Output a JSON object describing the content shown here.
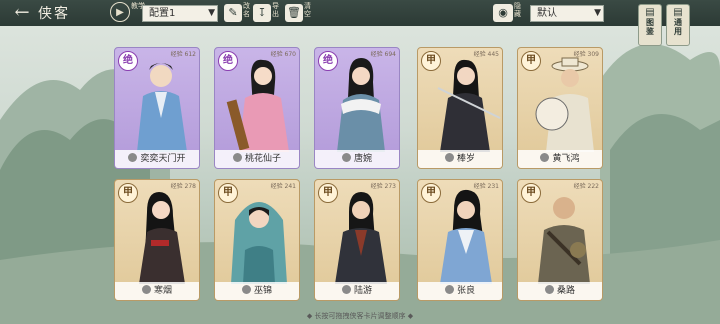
{
  "header": {
    "title": "侠客",
    "tutorial_label": "教学",
    "config_select": "配置1",
    "edit_label": "改名",
    "export_label": "导出",
    "clear_label": "清空",
    "hide_label": "隐藏",
    "sort_select": "默认"
  },
  "side_buttons": [
    {
      "label": "图鉴"
    },
    {
      "label": "通用"
    }
  ],
  "cards": [
    {
      "name": "奕奕天门开",
      "rank": "绝",
      "level": "经验 612",
      "style": "purple"
    },
    {
      "name": "桃花仙子",
      "rank": "绝",
      "level": "经验 670",
      "style": "purple"
    },
    {
      "name": "唐婉",
      "rank": "绝",
      "level": "经验 694",
      "style": "purple"
    },
    {
      "name": "棒岁",
      "rank": "甲",
      "level": "经验 445",
      "style": "tan"
    },
    {
      "name": "黄飞鸿",
      "rank": "甲",
      "level": "经验 309",
      "style": "tan"
    },
    {
      "name": "寒烟",
      "rank": "甲",
      "level": "经验 278",
      "style": "tan"
    },
    {
      "name": "巫锦",
      "rank": "甲",
      "level": "经验 241",
      "style": "tan"
    },
    {
      "name": "陆游",
      "rank": "甲",
      "level": "经验 273",
      "style": "tan"
    },
    {
      "name": "张良",
      "rank": "甲",
      "level": "经验 231",
      "style": "tan"
    },
    {
      "name": "桑路",
      "rank": "甲",
      "level": "经验 222",
      "style": "tan"
    }
  ],
  "footer": {
    "hint": "◆ 长按可拖拽侠客卡片调整顺序 ◆"
  }
}
